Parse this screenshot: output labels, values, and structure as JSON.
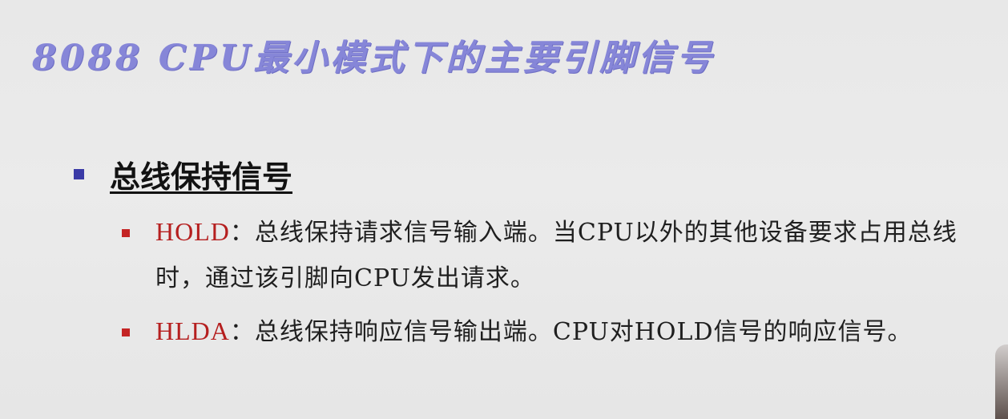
{
  "slide": {
    "title": "8088 CPU最小模式下的主要引脚信号",
    "section": {
      "heading": "总线保持信号"
    },
    "items": [
      {
        "term": "HOLD",
        "description": "：总线保持请求信号输入端。当CPU以外的其他设备要求占用总线时，通过该引脚向CPU发出请求。"
      },
      {
        "term": "HLDA",
        "description": "：总线保持响应信号输出端。CPU对HOLD信号的响应信号。"
      }
    ]
  },
  "colors": {
    "title": "#8686d8",
    "heading": "#121212",
    "term": "#b51f1f",
    "bullet_primary": "#3a3aa6",
    "bullet_secondary": "#c42424",
    "background": "#eaeaea"
  }
}
